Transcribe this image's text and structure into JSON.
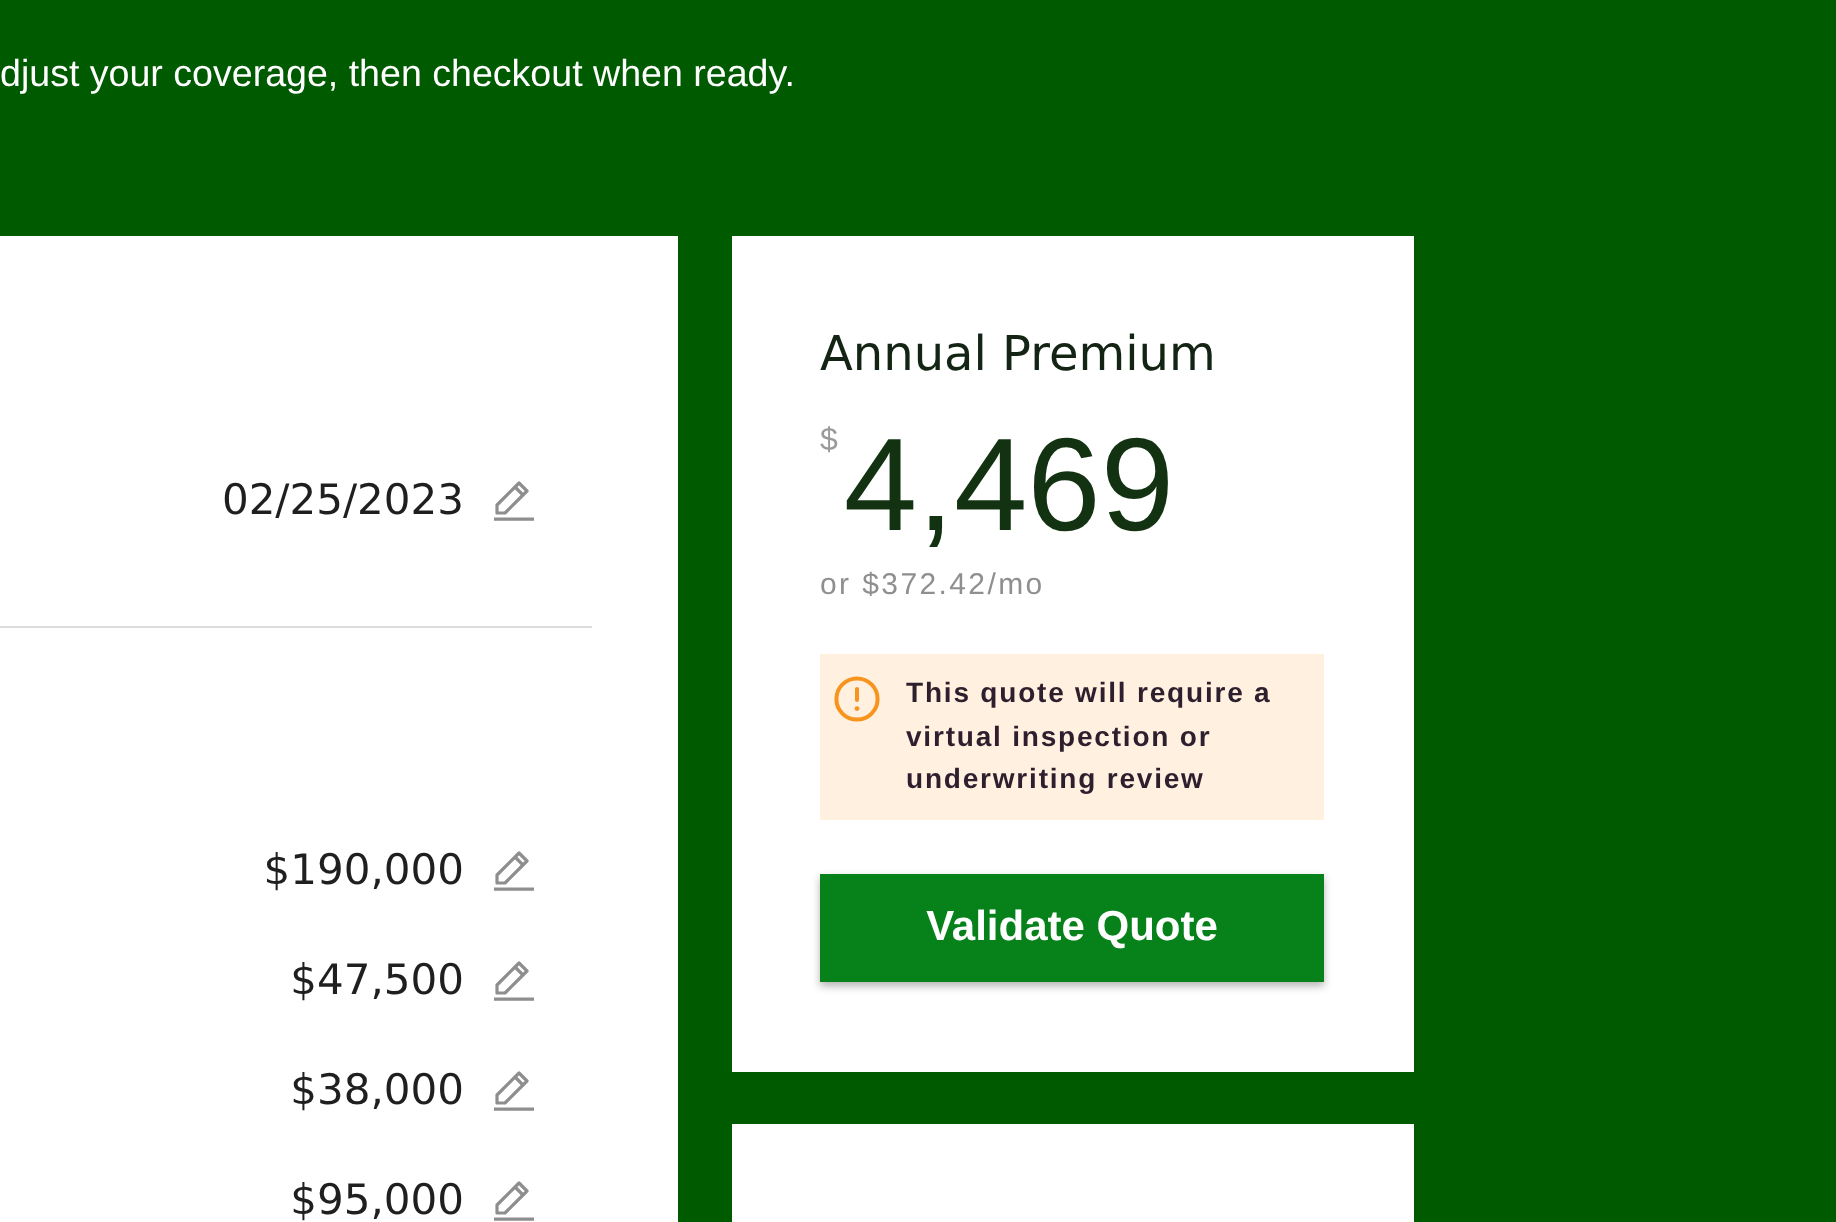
{
  "header": {
    "subtitle": "djust your coverage, then checkout when ready."
  },
  "details_card": {
    "sections": [
      {
        "rows": [
          {
            "value": "02/25/2023"
          }
        ]
      },
      {
        "rows": [
          {
            "value": "$190,000"
          },
          {
            "value": "$47,500"
          },
          {
            "value": "$38,000"
          },
          {
            "value": "$95,000"
          }
        ]
      }
    ]
  },
  "premium_card": {
    "title": "Annual Premium",
    "currency": "$",
    "amount": "4,469",
    "monthly": "or $372.42/mo",
    "notice": "This quote will require a virtual inspection or underwriting review",
    "button": "Validate Quote"
  }
}
